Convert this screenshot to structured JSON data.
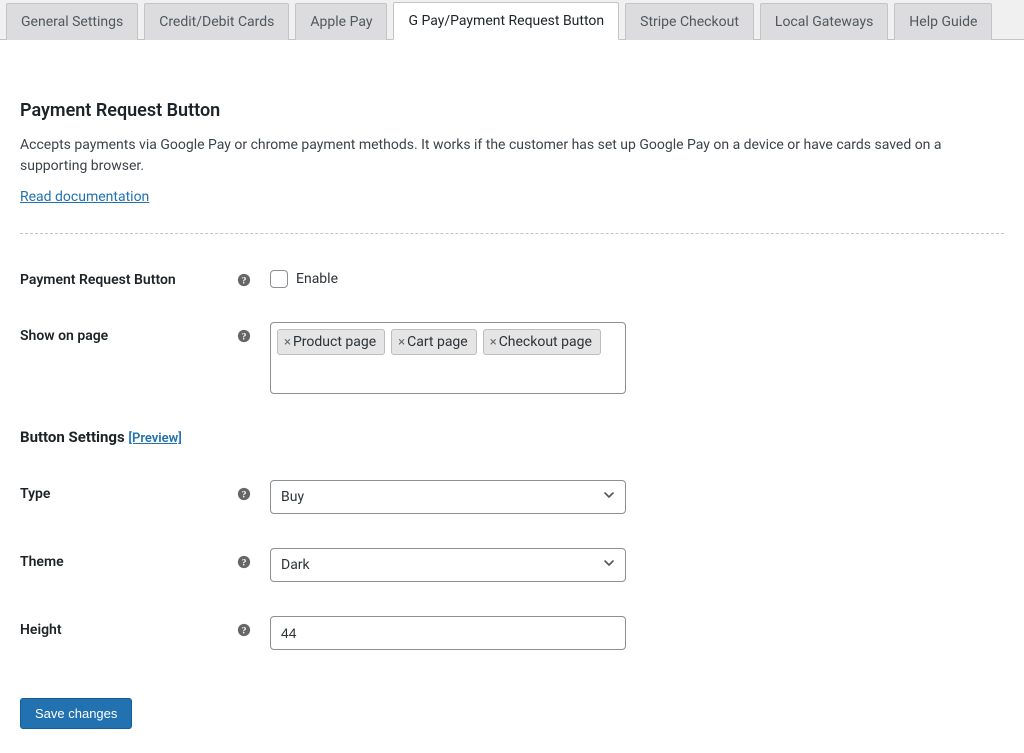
{
  "tabs": [
    {
      "label": "General Settings"
    },
    {
      "label": "Credit/Debit Cards"
    },
    {
      "label": "Apple Pay"
    },
    {
      "label": "G Pay/Payment Request Button"
    },
    {
      "label": "Stripe Checkout"
    },
    {
      "label": "Local Gateways"
    },
    {
      "label": "Help Guide"
    }
  ],
  "header": {
    "title": "Payment Request Button",
    "description": "Accepts payments via Google Pay or chrome payment methods. It works if the customer has set up Google Pay on a device or have cards saved on a supporting browser.",
    "read_link": "Read documentation"
  },
  "fields": {
    "enable_label": "Payment Request Button",
    "enable_checkbox_label": "Enable",
    "show_on_page_label": "Show on page",
    "show_on_page_values": [
      "Product page",
      "Cart page",
      "Checkout page"
    ],
    "button_settings_heading": "Button Settings",
    "preview_link": "[Preview]",
    "type_label": "Type",
    "type_value": "Buy",
    "theme_label": "Theme",
    "theme_value": "Dark",
    "height_label": "Height",
    "height_value": "44",
    "save_label": "Save changes"
  }
}
